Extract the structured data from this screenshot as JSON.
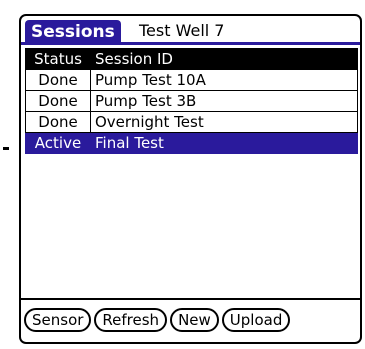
{
  "title": {
    "app_tab": "Sessions",
    "subtitle": "Test Well 7"
  },
  "table": {
    "headers": [
      "Status",
      "Session ID"
    ],
    "rows": [
      {
        "status": "Done",
        "session_id": "Pump Test 10A"
      },
      {
        "status": "Done",
        "session_id": "Pump Test 3B"
      },
      {
        "status": "Done",
        "session_id": "Overnight Test"
      },
      {
        "status": "Active",
        "session_id": "Final Test",
        "selected": true
      }
    ]
  },
  "buttons": {
    "sensor": "Sensor",
    "refresh": "Refresh",
    "new": "New",
    "upload": "Upload"
  },
  "colors": {
    "accent": "#2a1a9c",
    "header_bg": "#000000"
  }
}
